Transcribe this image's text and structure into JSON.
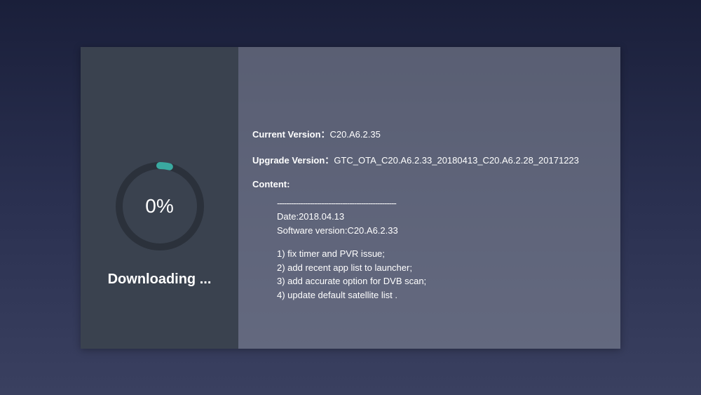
{
  "progress": {
    "percent_text": "0%",
    "percent_value": 0,
    "status_text": "Downloading ..."
  },
  "info": {
    "current_version_label": "Current Version：",
    "current_version_value": "C20.A6.2.35",
    "upgrade_version_label": "Upgrade Version：",
    "upgrade_version_value": "GTC_OTA_C20.A6.2.33_20180413_C20.A6.2.28_20171223",
    "content_label": "Content:"
  },
  "content": {
    "divider": "---------------------------------------------------",
    "date_line": "Date:2018.04.13",
    "software_version_line": "Software version:C20.A6.2.33",
    "items": [
      "1) fix timer and PVR issue;",
      "2) add recent app list to launcher;",
      "3) add accurate option for DVB scan;",
      "4) update default satellite list ."
    ]
  },
  "colors": {
    "ring_bg": "#2b313b",
    "ring_fill": "#3aa9a0"
  }
}
